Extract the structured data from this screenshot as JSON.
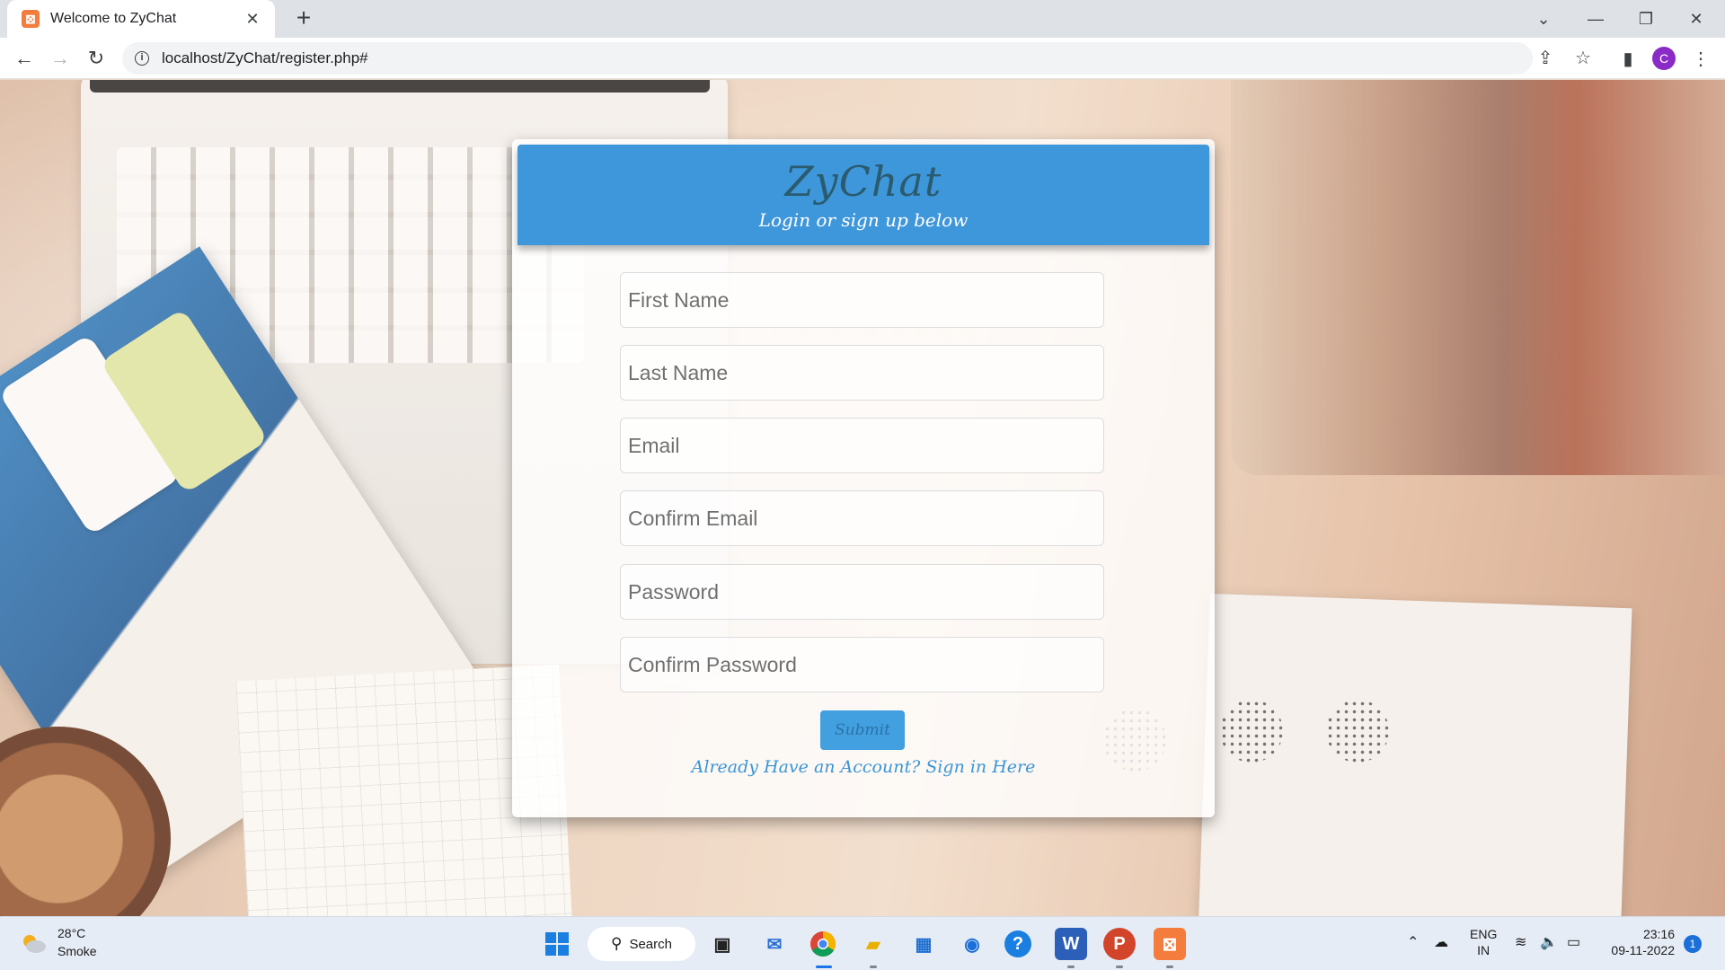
{
  "browser": {
    "tab_title": "Welcome to ZyChat",
    "tab_favicon": "xampp-icon",
    "new_tab_label": "+",
    "url": "localhost/ZyChat/register.php#",
    "profile_initial": "C"
  },
  "header": {
    "brand": "ZyChat",
    "tagline": "Login or sign up below"
  },
  "form": {
    "first_name_placeholder": "First Name",
    "last_name_placeholder": "Last Name",
    "email_placeholder": "Email",
    "confirm_email_placeholder": "Confirm Email",
    "password_placeholder": "Password",
    "confirm_password_placeholder": "Confirm Password",
    "submit_label": "Submit",
    "signin_link": "Already Have an Account? Sign in Here"
  },
  "taskbar": {
    "weather_temp": "28°C",
    "weather_desc": "Smoke",
    "search_label": "Search",
    "lang_line1": "ENG",
    "lang_line2": "IN",
    "time": "23:16",
    "date": "09-11-2022",
    "notification_count": "1"
  },
  "colors": {
    "header_blue": "#3e97da",
    "brand_text": "#2a5b6e",
    "link_blue": "#3a95d5",
    "profile_purple": "#8b2bc7"
  }
}
